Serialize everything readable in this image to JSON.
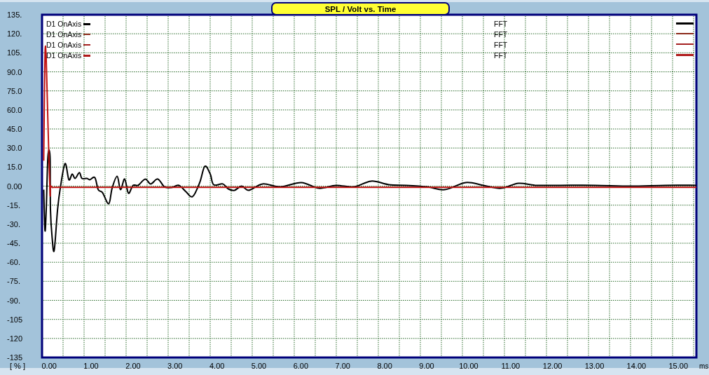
{
  "chart": {
    "legend": [
      {
        "label": "D1 OnAxis",
        "type": "FFT",
        "color": "#000000",
        "kind": "thick"
      },
      {
        "label": "D1 OnAxis",
        "type": "FFT",
        "color": "#8b2a1a",
        "kind": "thin"
      },
      {
        "label": "D1 OnAxis",
        "type": "FFT",
        "color": "#a52020",
        "kind": "thin"
      },
      {
        "label": "D1 OnAxis",
        "type": "FFT",
        "color": "#b01818",
        "kind": "thick"
      }
    ],
    "chart_data": {
      "type": "line",
      "grid": true,
      "title": "SPL / Volt vs. Time",
      "xlabel": "ms",
      "ylabel": "[ % ]",
      "xlim": [
        -0.17,
        15.43
      ],
      "ylim": [
        -135,
        135
      ],
      "x": [
        -0.13,
        -0.1,
        -0.07,
        -0.03,
        0.02,
        0.03,
        0.07,
        0.12,
        0.2,
        0.27,
        0.38,
        0.47,
        0.55,
        0.62,
        0.72,
        0.78,
        0.9,
        0.97,
        1.09,
        1.17,
        1.27,
        1.42,
        1.5,
        1.62,
        1.7,
        1.8,
        1.89,
        2.0,
        2.12,
        2.29,
        2.42,
        2.59,
        2.75,
        2.92,
        3.09,
        3.26,
        3.42,
        3.59,
        3.71,
        3.84,
        3.92,
        4.14,
        4.27,
        4.42,
        4.59,
        4.76,
        5.09,
        5.51,
        6.01,
        6.43,
        6.84,
        7.26,
        7.68,
        8.1,
        8.51,
        9.02,
        9.43,
        9.93,
        10.35,
        10.77,
        11.19,
        11.6,
        12.19,
        13.02,
        13.86,
        14.69,
        15.43
      ],
      "series": [
        {
          "color": "#000000",
          "values": [
            -2.8,
            -35,
            -18.3,
            23.3,
            23.3,
            -18.3,
            -40.6,
            -50.6,
            -18.3,
            -0.6,
            17.8,
            5,
            9.5,
            6.1,
            10.6,
            6.1,
            6.1,
            5,
            6.7,
            -2.8,
            -5,
            -13.9,
            -1.7,
            7.8,
            -2.8,
            5.6,
            -5.6,
            0.6,
            0.6,
            5.6,
            1.7,
            5.6,
            -0.6,
            -1.1,
            0.6,
            -4.4,
            -8.3,
            2.8,
            15.6,
            9.5,
            1.1,
            1.7,
            -2.2,
            -3.3,
            0,
            -3.3,
            1.7,
            -0.6,
            2.8,
            -1.7,
            0.6,
            -0.6,
            3.9,
            1.1,
            0.6,
            -0.6,
            -2.8,
            2.8,
            0.6,
            -1.7,
            2.2,
            0.6,
            0.6,
            0.6,
            0,
            0.6,
            0.6
          ]
        },
        {
          "color": "#c01010",
          "values": [
            20,
            103,
            100,
            50,
            -5,
            0,
            -1,
            -1,
            -1,
            -1,
            -1,
            -1,
            -1,
            -1,
            -1,
            -1,
            -1,
            -1,
            -1,
            -1,
            -1,
            -1,
            -1,
            -1,
            -1,
            -1,
            -1,
            -1,
            -1,
            -1,
            -1,
            -1,
            -1,
            -1,
            -1,
            -1,
            -1,
            -1,
            -1,
            -1,
            -1,
            -1,
            -1,
            -1,
            -1,
            -1,
            -1,
            -1,
            -1,
            -1,
            -1,
            -1,
            -1,
            -1,
            -1,
            -1,
            -1,
            -1,
            -1,
            -1,
            -1,
            -1,
            -1,
            -1,
            -1,
            -1,
            -1
          ]
        }
      ],
      "xticks": [
        {
          "value": 0,
          "label": "0.00"
        },
        {
          "value": 1,
          "label": "1.00"
        },
        {
          "value": 2,
          "label": "2.00"
        },
        {
          "value": 3,
          "label": "3.00"
        },
        {
          "value": 4,
          "label": "4.00"
        },
        {
          "value": 5,
          "label": "5.00"
        },
        {
          "value": 6,
          "label": "6.00"
        },
        {
          "value": 7,
          "label": "7.00"
        },
        {
          "value": 8,
          "label": "8.00"
        },
        {
          "value": 9,
          "label": "9.00"
        },
        {
          "value": 10,
          "label": "10.00"
        },
        {
          "value": 11,
          "label": "11.00"
        },
        {
          "value": 12,
          "label": "12.00"
        },
        {
          "value": 13,
          "label": "13.00"
        },
        {
          "value": 14,
          "label": "14.00"
        },
        {
          "value": 15,
          "label": "15.00"
        }
      ],
      "yticks": [
        {
          "value": 135,
          "label": "135."
        },
        {
          "value": 120,
          "label": "120."
        },
        {
          "value": 105,
          "label": "105."
        },
        {
          "value": 90,
          "label": "90.0"
        },
        {
          "value": 75,
          "label": "75.0"
        },
        {
          "value": 60,
          "label": "60.0"
        },
        {
          "value": 45,
          "label": "45.0"
        },
        {
          "value": 30,
          "label": "30.0"
        },
        {
          "value": 15,
          "label": "15.0"
        },
        {
          "value": 0,
          "label": "0.00"
        },
        {
          "value": -15,
          "label": "-15."
        },
        {
          "value": -30,
          "label": "-30."
        },
        {
          "value": -45,
          "label": "-45."
        },
        {
          "value": -60,
          "label": "-60."
        },
        {
          "value": -75,
          "label": "-75."
        },
        {
          "value": -90,
          "label": "-90."
        },
        {
          "value": -105,
          "label": "-105"
        },
        {
          "value": -120,
          "label": "-120"
        },
        {
          "value": -135,
          "label": "-135"
        }
      ]
    }
  }
}
